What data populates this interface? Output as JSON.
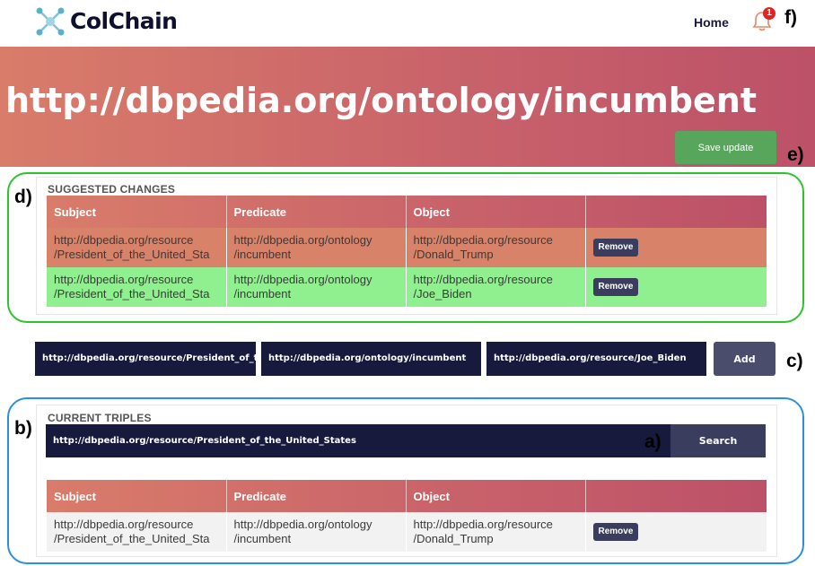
{
  "header": {
    "logo_text": "ColChain",
    "nav_home": "Home",
    "notification_count": "1"
  },
  "hero": {
    "title": "http://dbpedia.org/ontology/incumbent",
    "save_label": "Save update"
  },
  "annotations": {
    "a": "a)",
    "b": "b)",
    "c": "c)",
    "d": "d)",
    "e": "e)",
    "f": "f)"
  },
  "suggested": {
    "title": "SUGGESTED CHANGES",
    "columns": [
      "Subject",
      "Predicate",
      "Object",
      ""
    ],
    "rows": [
      {
        "subject_1": "http://dbpedia.org/resource",
        "subject_2": "/President_of_the_United_Sta",
        "predicate_1": "http://dbpedia.org/ontology",
        "predicate_2": "/incumbent",
        "object_1": "http://dbpedia.org/resource",
        "object_2": "/Donald_Trump",
        "action": "Remove",
        "status": "removed",
        "color": "#d9826a"
      },
      {
        "subject_1": "http://dbpedia.org/resource",
        "subject_2": "/President_of_the_United_Sta",
        "predicate_1": "http://dbpedia.org/ontology",
        "predicate_2": "/incumbent",
        "object_1": "http://dbpedia.org/resource",
        "object_2": "/Joe_Biden",
        "action": "Remove",
        "status": "added",
        "color": "#90f090"
      }
    ]
  },
  "add_form": {
    "subject_value": "http://dbpedia.org/resource/President_of_t",
    "predicate_value": "http://dbpedia.org/ontology/incumbent",
    "object_value": "http://dbpedia.org/resource/Joe_Biden",
    "add_label": "Add"
  },
  "current": {
    "title": "CURRENT TRIPLES",
    "search_value": "http://dbpedia.org/resource/President_of_the_United_States",
    "search_label": "Search",
    "columns": [
      "Subject",
      "Predicate",
      "Object",
      ""
    ],
    "rows": [
      {
        "subject_1": "http://dbpedia.org/resource",
        "subject_2": "/President_of_the_United_Sta",
        "predicate_1": "http://dbpedia.org/ontology",
        "predicate_2": "/incumbent",
        "object_1": "http://dbpedia.org/resource",
        "object_2": "/Donald_Trump",
        "action": "Remove"
      }
    ]
  },
  "colors": {
    "brand_dark": "#17193d",
    "accent_gradient_start": "#d97c6a",
    "accent_gradient_end": "#bc5168",
    "save_green": "#58a65c",
    "outline_green": "#2bc52b",
    "outline_blue": "#2b8fe0"
  }
}
